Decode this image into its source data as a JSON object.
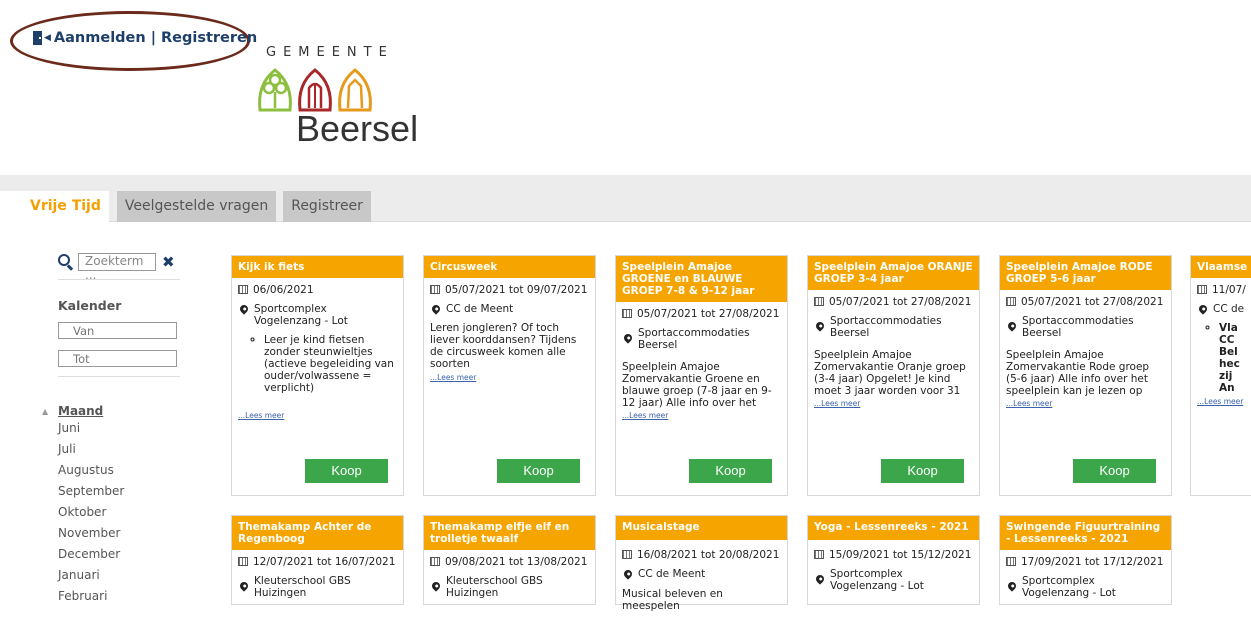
{
  "auth": {
    "login": "Aanmelden",
    "separator": "|",
    "register": "Registreren"
  },
  "logo": {
    "top": "GEMEENTE",
    "name": "Beersel"
  },
  "nav": {
    "tabs": [
      "Vrije Tijd",
      "Veelgestelde vragen",
      "Registreer"
    ]
  },
  "sidebar": {
    "search_placeholder": "Zoekterm ...",
    "calendar_title": "Kalender",
    "van": "Van",
    "tot": "Tot",
    "month_header": "Maand",
    "months": [
      "Juni",
      "Juli",
      "Augustus",
      "September",
      "Oktober",
      "November",
      "December",
      "Januari",
      "Februari"
    ]
  },
  "koop_label": "Koop",
  "lees_meer": "...Lees meer",
  "cards": [
    {
      "title": "Kijk ik fiets",
      "date": "06/06/2021",
      "location": "Sportcomplex Vogelenzang - Lot",
      "bullet": "Leer je kind fietsen zonder steunwieltjes (actieve begeleiding van ouder/volwassene = verplicht)"
    },
    {
      "title": "Circusweek",
      "date": "05/07/2021 tot 09/07/2021",
      "location": "CC de Meent",
      "text": "Leren jongleren? Of toch liever koorddansen? Tijdens de circusweek komen alle soorten"
    },
    {
      "title": "Speelplein Amajoe GROENE en BLAUWE GROEP 7-8 & 9-12 jaar",
      "date": "05/07/2021 tot 27/08/2021",
      "location": "Sportaccommodaties Beersel",
      "text": "Speelplein Amajoe Zomervakantie Groene en blauwe groep (7-8 jaar en 9-12 jaar) Alle info over het"
    },
    {
      "title": "Speelplein Amajoe ORANJE GROEP 3-4 jaar",
      "date": "05/07/2021 tot 27/08/2021",
      "location": "Sportaccommodaties Beersel",
      "text": "Speelplein Amajoe Zomervakantie Oranje groep (3-4 jaar) Opgelet! Je kind moet 3 jaar worden voor 31"
    },
    {
      "title": "Speelplein Amajoe RODE GROEP 5-6 jaar",
      "date": "05/07/2021 tot 27/08/2021",
      "location": "Sportaccommodaties Beersel",
      "text": "Speelplein Amajoe Zomervakantie Rode groep (5-6 jaar) Alle info over het speelplein kan je lezen op"
    },
    {
      "title": "Vlaamse",
      "date": "11/07/",
      "location": "CC de",
      "bullet": "Vla CC Bel hec zij An"
    },
    {
      "title": "Themakamp Achter de Regenboog",
      "date": "12/07/2021 tot 16/07/2021",
      "location": "Kleuterschool GBS Huizingen"
    },
    {
      "title": "Themakamp elfje elf en trolletje twaalf",
      "date": "09/08/2021 tot 13/08/2021",
      "location": "Kleuterschool GBS Huizingen"
    },
    {
      "title": "Musicalstage",
      "date": "16/08/2021 tot 20/08/2021",
      "location": "CC de Meent",
      "text": "Musical beleven en meespelen"
    },
    {
      "title": "Yoga - Lessenreeks - 2021",
      "date": "15/09/2021 tot 15/12/2021",
      "location": "Sportcomplex Vogelenzang - Lot"
    },
    {
      "title": "Swingende Figuurtraining - Lessenreeks - 2021",
      "date": "17/09/2021 tot 17/12/2021",
      "location": "Sportcomplex Vogelenzang - Lot"
    }
  ]
}
